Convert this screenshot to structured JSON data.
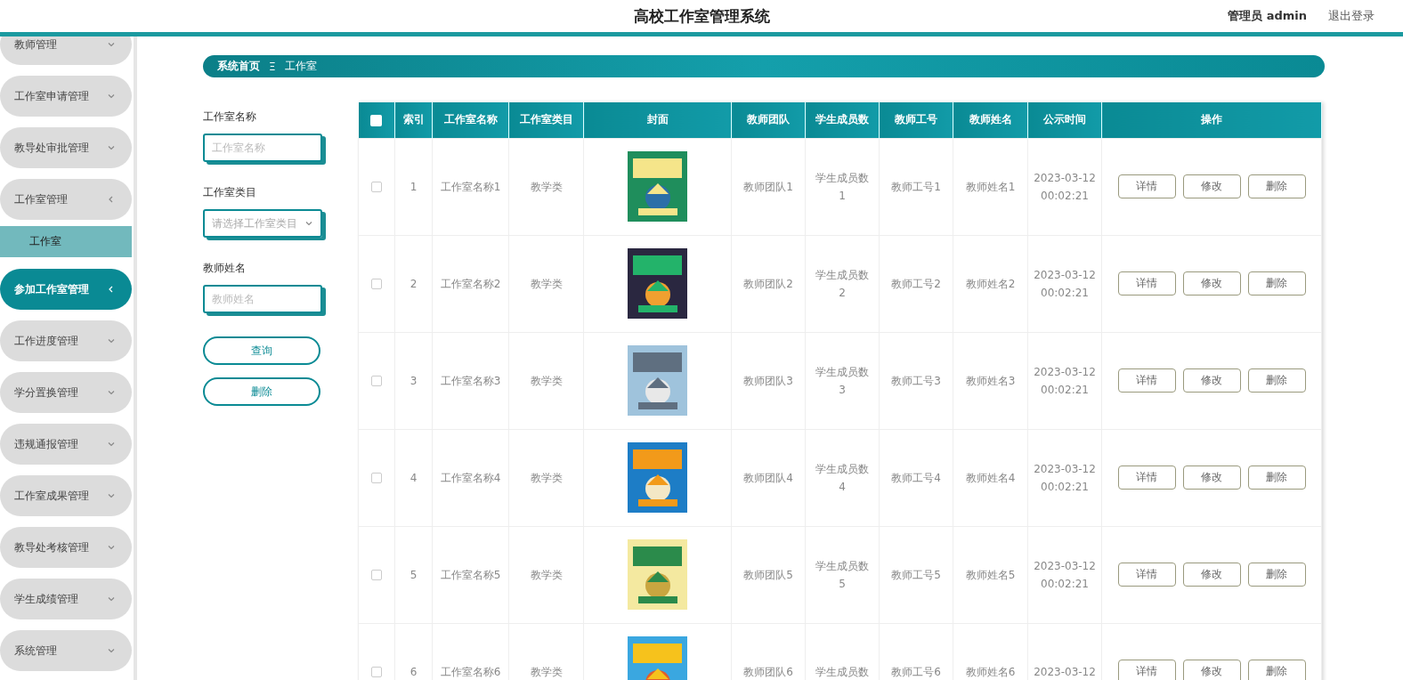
{
  "header": {
    "title": "高校工作室管理系统",
    "user": "管理员 admin",
    "logout": "退出登录"
  },
  "sidebar": {
    "items": [
      {
        "label": "教师管理",
        "expanded": false,
        "selected": false
      },
      {
        "label": "工作室申请管理",
        "expanded": false,
        "selected": false
      },
      {
        "label": "教导处审批管理",
        "expanded": false,
        "selected": false
      },
      {
        "label": "工作室管理",
        "expanded": true,
        "selected": false,
        "children": [
          {
            "label": "工作室",
            "selected": true
          }
        ]
      },
      {
        "label": "参加工作室管理",
        "expanded": true,
        "selected": true
      },
      {
        "label": "工作进度管理",
        "expanded": false,
        "selected": false
      },
      {
        "label": "学分置换管理",
        "expanded": false,
        "selected": false
      },
      {
        "label": "违规通报管理",
        "expanded": false,
        "selected": false
      },
      {
        "label": "工作室成果管理",
        "expanded": false,
        "selected": false
      },
      {
        "label": "教导处考核管理",
        "expanded": false,
        "selected": false
      },
      {
        "label": "学生成绩管理",
        "expanded": false,
        "selected": false
      },
      {
        "label": "系统管理",
        "expanded": false,
        "selected": false
      }
    ]
  },
  "breadcrumb": {
    "home": "系统首页",
    "separator": "Ξ",
    "current": "工作室"
  },
  "filters": {
    "fields": [
      {
        "kind": "text",
        "label": "工作室名称",
        "placeholder": "工作室名称"
      },
      {
        "kind": "select",
        "label": "工作室类目",
        "placeholder": "请选择工作室类目"
      },
      {
        "kind": "text",
        "label": "教师姓名",
        "placeholder": "教师姓名"
      }
    ],
    "buttons": [
      "查询",
      "删除"
    ]
  },
  "table": {
    "columns": [
      "索引",
      "工作室名称",
      "工作室类目",
      "封面",
      "教师团队",
      "学生成员数",
      "教师工号",
      "教师姓名",
      "公示时间",
      "操作"
    ],
    "all_selected": false,
    "rows": [
      {
        "selected": false,
        "index": "1",
        "name": "工作室名称1",
        "category": "教学类",
        "cover": {
          "kind": "picture"
        },
        "team": "教师团队1",
        "students": [
          "学生成员数",
          "1"
        ],
        "teacher_id": "教师工号1",
        "teacher_name": "教师姓名1",
        "time": [
          "2023-03-12",
          "00:02:21"
        ],
        "actions": [
          "详情",
          "修改",
          "删除"
        ]
      },
      {
        "selected": false,
        "index": "2",
        "name": "工作室名称2",
        "category": "教学类",
        "cover": {
          "kind": "picture"
        },
        "team": "教师团队2",
        "students": [
          "学生成员数",
          "2"
        ],
        "teacher_id": "教师工号2",
        "teacher_name": "教师姓名2",
        "time": [
          "2023-03-12",
          "00:02:21"
        ],
        "actions": [
          "详情",
          "修改",
          "删除"
        ]
      },
      {
        "selected": false,
        "index": "3",
        "name": "工作室名称3",
        "category": "教学类",
        "cover": {
          "kind": "picture"
        },
        "team": "教师团队3",
        "students": [
          "学生成员数",
          "3"
        ],
        "teacher_id": "教师工号3",
        "teacher_name": "教师姓名3",
        "time": [
          "2023-03-12",
          "00:02:21"
        ],
        "actions": [
          "详情",
          "修改",
          "删除"
        ]
      },
      {
        "selected": false,
        "index": "4",
        "name": "工作室名称4",
        "category": "教学类",
        "cover": {
          "kind": "picture"
        },
        "team": "教师团队4",
        "students": [
          "学生成员数",
          "4"
        ],
        "teacher_id": "教师工号4",
        "teacher_name": "教师姓名4",
        "time": [
          "2023-03-12",
          "00:02:21"
        ],
        "actions": [
          "详情",
          "修改",
          "删除"
        ]
      },
      {
        "selected": false,
        "index": "5",
        "name": "工作室名称5",
        "category": "教学类",
        "cover": {
          "kind": "picture"
        },
        "team": "教师团队5",
        "students": [
          "学生成员数",
          "5"
        ],
        "teacher_id": "教师工号5",
        "teacher_name": "教师姓名5",
        "time": [
          "2023-03-12",
          "00:02:21"
        ],
        "actions": [
          "详情",
          "修改",
          "删除"
        ]
      },
      {
        "selected": false,
        "index": "6",
        "name": "工作室名称6",
        "category": "教学类",
        "cover": {
          "kind": "picture"
        },
        "team": "教师团队6",
        "students": [
          "学生成员数"
        ],
        "teacher_id": "教师工号6",
        "teacher_name": "教师姓名6",
        "time": [
          "2023-03-12"
        ],
        "actions": [
          "详情",
          "修改",
          "删除"
        ]
      }
    ]
  }
}
